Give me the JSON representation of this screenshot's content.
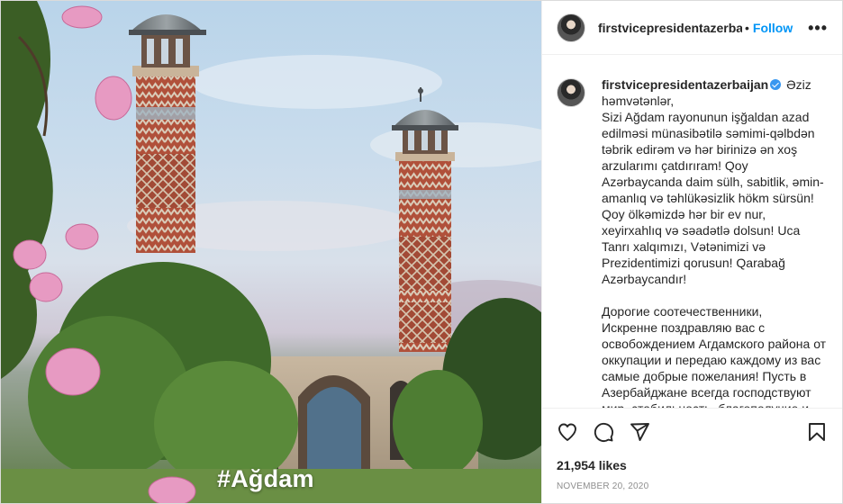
{
  "photo": {
    "alt_caption": "#Ağdam",
    "overlay_text": "#Ağdam"
  },
  "header": {
    "username": "firstvicepresidentazerbaij:",
    "separator": "•",
    "follow_label": "Follow",
    "more_label": "•••"
  },
  "caption": {
    "username": "firstvicepresidentazerbaijan",
    "paragraph_az": "Əziz həmvətənlər,\nSizi Ağdam rayonunun işğaldan azad edilməsi münasibətilə səmimi-qəlbdən təbrik edirəm və hər birinizə ən xoş arzularımı çatdırıram! Qoy Azərbaycanda daim sülh, sabitlik, əmin-amanlıq və təhlükəsizlik hökm sürsün! Qoy ölkəmizdə hər bir ev nur, xeyirxahlıq və səadətlə dolsun! Uca Tanrı xalqımızı, Vətənimizi və Prezidentimizi qorusun! Qarabağ Azərbaycandır!",
    "paragraph_ru": "Дорогие соотечественники,\nИскренне поздравляю вас с освобождением Агдамского района от оккупации и передаю каждому из вас самые добрые пожелания! Пусть в Азербайджане всегда господствуют мир, стабильность, благополучие и безопасность! Пусть каждый дом в"
  },
  "actions": {
    "like_icon": "heart-icon",
    "comment_icon": "comment-icon",
    "share_icon": "paper-plane-icon",
    "save_icon": "bookmark-icon"
  },
  "likes": {
    "text": "21,954 likes"
  },
  "date": {
    "text": "NOVEMBER 20, 2020"
  },
  "colors": {
    "accent": "#0095f6",
    "verified": "#3897f0",
    "text": "#262626",
    "muted": "#8e8e8e"
  }
}
